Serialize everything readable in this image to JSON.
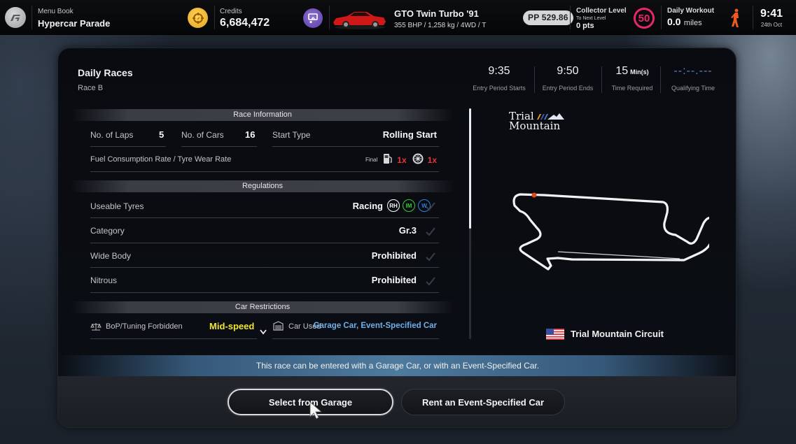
{
  "topbar": {
    "menu_book_label": "Menu Book",
    "menu_book_value": "Hypercar Parade",
    "credits_label": "Credits",
    "credits_value": "6,684,472",
    "car_name": "GTO Twin Turbo '91",
    "car_specs": "355 BHP / 1,258 kg / 4WD / T",
    "pp": "PP 529.86",
    "collector_label": "Collector Level",
    "collector_sub": "To Next Level",
    "collector_pts": "0 pts",
    "collector_level": "50",
    "workout_label": "Daily Workout",
    "workout_value": "0.0",
    "workout_unit": "miles",
    "clock": "9:41",
    "date": "24th Oct",
    "colors": {
      "level": "#e8266c",
      "credits": "#f2b630",
      "runner": "#f05a1e"
    }
  },
  "race": {
    "title": "Daily Races",
    "subtitle": "Race B",
    "times": [
      {
        "value": "9:35",
        "unit": "",
        "label": "Entry Period Starts"
      },
      {
        "value": "9:50",
        "unit": "",
        "label": "Entry Period Ends"
      },
      {
        "value": "15",
        "unit": "Min(s)",
        "label": "Time Required"
      },
      {
        "value": "--:--.---",
        "unit": "",
        "label": "Qualifying Time"
      }
    ]
  },
  "race_info": {
    "header": "Race Information",
    "laps_label": "No. of Laps",
    "laps_value": "5",
    "cars_label": "No. of Cars",
    "cars_value": "16",
    "start_label": "Start Type",
    "start_value": "Rolling Start",
    "rate_label": "Fuel Consumption Rate / Tyre Wear Rate",
    "rate_final": "Final",
    "fuel_rate": "1x",
    "tyre_rate": "1x"
  },
  "regulations": {
    "header": "Regulations",
    "rows": [
      {
        "label": "Useable Tyres",
        "value": "Racing",
        "tyres": [
          "RH",
          "IM",
          "W"
        ]
      },
      {
        "label": "Category",
        "value": "Gr.3"
      },
      {
        "label": "Wide Body",
        "value": "Prohibited"
      },
      {
        "label": "Nitrous",
        "value": "Prohibited"
      }
    ],
    "tyre_colors": {
      "RH": "#ffffff",
      "IM": "#3cc93c",
      "W": "#2f7fe0"
    }
  },
  "car_restrictions": {
    "header": "Car Restrictions",
    "bop_label": "BoP/Tuning Forbidden",
    "bop_value": "Mid-speed",
    "car_used_label": "Car Used",
    "car_used_value": "Garage Car, Event-Specified Car"
  },
  "track": {
    "logo_line1": "Trial",
    "logo_line2": "Mountain",
    "name": "Trial Mountain Circuit"
  },
  "info_message": "This race can be entered with a Garage Car, or with an Event-Specified Car.",
  "buttons": {
    "garage": "Select from Garage",
    "rent": "Rent an Event-Specified Car"
  }
}
